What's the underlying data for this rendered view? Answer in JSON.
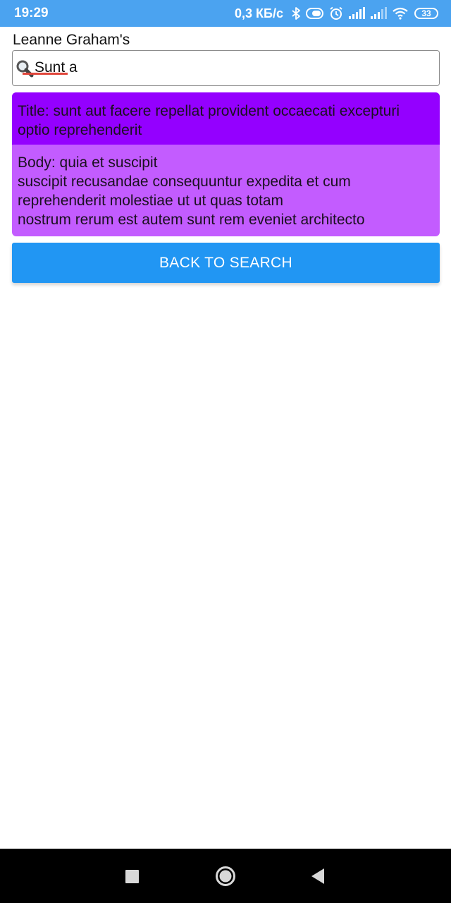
{
  "status_bar": {
    "time": "19:29",
    "network_speed": "0,3 КБ/с",
    "battery_level": "33",
    "icons": [
      "bluetooth-icon",
      "data-saver-icon",
      "alarm-icon",
      "signal-icon",
      "signal-icon",
      "wifi-icon",
      "battery-icon"
    ]
  },
  "header": {
    "title": "Leanne Graham's"
  },
  "search": {
    "value": "Sunt a",
    "icon": "magnifier-icon"
  },
  "post": {
    "title": "Title: sunt aut facere repellat provident occaecati excepturi optio reprehenderit",
    "body_lines": [
      "Body: quia et suscipit",
      "suscipit recusandae consequuntur expedita et cum",
      "reprehenderit molestiae ut ut quas totam",
      "nostrum rerum est autem sunt rem eveniet architecto"
    ]
  },
  "actions": {
    "back_label": "BACK TO SEARCH"
  },
  "nav_bar": {
    "icons": [
      "recents-icon",
      "home-icon",
      "back-icon"
    ]
  },
  "colors": {
    "status_bar": "#4ba3f0",
    "title_bg": "#9400ff",
    "body_bg": "#c35cff",
    "button_bg": "#2196f3",
    "nav_bar": "#000000"
  }
}
